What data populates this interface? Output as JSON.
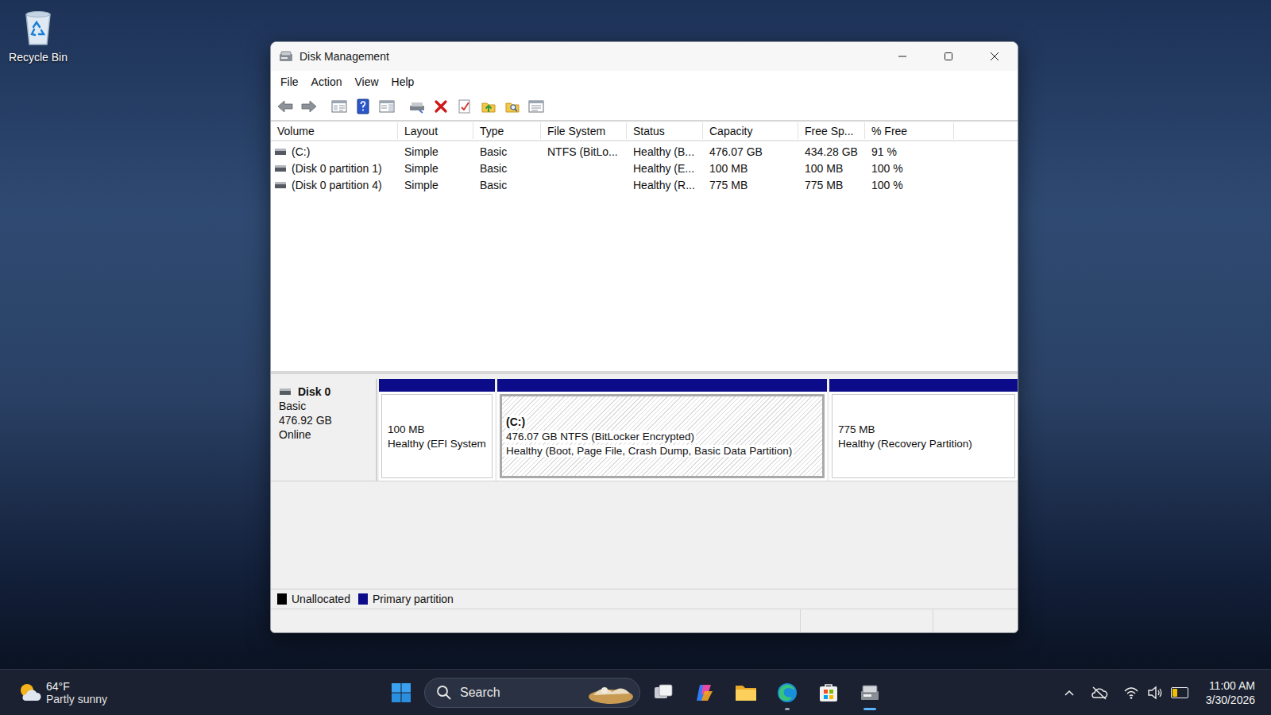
{
  "desktop": {
    "icons": [
      {
        "label": "Recycle Bin"
      }
    ]
  },
  "window": {
    "title": "Disk Management"
  },
  "menu": [
    {
      "label": "File"
    },
    {
      "label": "Action"
    },
    {
      "label": "View"
    },
    {
      "label": "Help"
    }
  ],
  "table": {
    "columns": [
      "Volume",
      "Layout",
      "Type",
      "File System",
      "Status",
      "Capacity",
      "Free Sp...",
      "% Free"
    ],
    "rows": [
      {
        "cells": [
          "(C:)",
          "Simple",
          "Basic",
          "NTFS (BitLo...",
          "Healthy (B...",
          "476.07 GB",
          "434.28 GB",
          "91 %"
        ],
        "selected": false
      },
      {
        "cells": [
          "(Disk 0 partition 1)",
          "Simple",
          "Basic",
          "",
          "Healthy (E...",
          "100 MB",
          "100 MB",
          "100 %"
        ],
        "selected": false
      },
      {
        "cells": [
          "(Disk 0 partition 4)",
          "Simple",
          "Basic",
          "",
          "Healthy (R...",
          "775 MB",
          "775 MB",
          "100 %"
        ],
        "selected": false
      }
    ]
  },
  "disk": {
    "name": "Disk 0",
    "type": "Basic",
    "size": "476.92 GB",
    "state": "Online",
    "partitions": [
      {
        "heading": "",
        "lines": [
          "100 MB",
          "Healthy (EFI System"
        ],
        "kind": "primary",
        "selected": false
      },
      {
        "heading": "(C:)",
        "lines": [
          "476.07 GB NTFS (BitLocker Encrypted)",
          "Healthy (Boot, Page File, Crash Dump, Basic Data Partition)"
        ],
        "kind": "primary",
        "selected": true
      },
      {
        "heading": "",
        "lines": [
          "775 MB",
          "Healthy (Recovery Partition)"
        ],
        "kind": "primary",
        "selected": false
      }
    ]
  },
  "legend": [
    {
      "label": "Unallocated",
      "kind": "unallocated",
      "color": "#000000"
    },
    {
      "label": "Primary partition",
      "kind": "primary",
      "color": "#0c0c8a"
    }
  ],
  "taskbar": {
    "weather": {
      "temp": "64°F",
      "condition": "Partly sunny"
    },
    "search": {
      "placeholder": "Search"
    },
    "apps": [
      {
        "kind": "task-view",
        "running": false,
        "active": false
      },
      {
        "kind": "copilot",
        "running": false,
        "active": false
      },
      {
        "kind": "explorer",
        "running": false,
        "active": false
      },
      {
        "kind": "edge",
        "running": true,
        "active": false
      },
      {
        "kind": "store",
        "running": false,
        "active": false
      },
      {
        "kind": "disk-management",
        "running": true,
        "active": true
      }
    ],
    "battery": {
      "level": 0.45
    },
    "clock": {
      "time": "11:00 AM",
      "date": "3/30/2026"
    }
  }
}
